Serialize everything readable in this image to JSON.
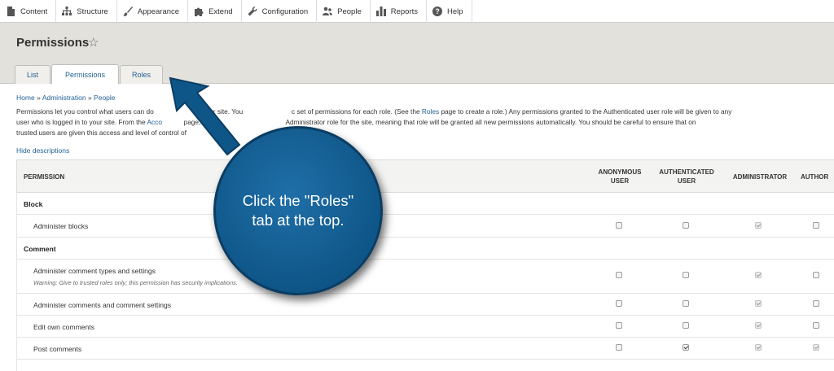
{
  "toolbar": {
    "items": [
      {
        "label": "Content",
        "icon": "document-icon"
      },
      {
        "label": "Structure",
        "icon": "structure-icon"
      },
      {
        "label": "Appearance",
        "icon": "paintbrush-icon"
      },
      {
        "label": "Extend",
        "icon": "puzzle-icon"
      },
      {
        "label": "Configuration",
        "icon": "wrench-icon"
      },
      {
        "label": "People",
        "icon": "people-icon"
      },
      {
        "label": "Reports",
        "icon": "bar-chart-icon"
      },
      {
        "label": "Help",
        "icon": "help-icon"
      }
    ]
  },
  "header": {
    "title": "Permissions",
    "tabs": [
      {
        "label": "List",
        "active": false
      },
      {
        "label": "Permissions",
        "active": true
      },
      {
        "label": "Roles",
        "active": false
      }
    ]
  },
  "breadcrumb": {
    "items": [
      "Home",
      "Administration",
      "People"
    ],
    "separator": "»"
  },
  "description": {
    "line1a": "Permissions let you control what users can do",
    "line1b": "your site. You",
    "line1c": "c set of permissions for each role. (See the",
    "roles_link": "Roles",
    "line1d": "page to create a role.) Any permissions granted to the Authenticated user role will be given to any",
    "line2a": "user who is logged in to your site. From the",
    "account_link": "Acco",
    "line2b": "page,",
    "line2c": "Administrator role for the site, meaning that role will be granted all new permissions automatically. You should be careful to ensure that on",
    "line3": "trusted users are given this access and level of control of",
    "hide_descriptions": "Hide descriptions"
  },
  "table": {
    "headers": {
      "permission": "PERMISSION",
      "anonymous": "ANONYMOUS USER",
      "authenticated": "AUTHENTICATED USER",
      "administrator": "ADMINISTRATOR",
      "author": "AUTHOR"
    },
    "categories": [
      {
        "name": "Block",
        "permissions": [
          {
            "name": "Administer blocks",
            "warning": "",
            "anonymous": false,
            "authenticated": false,
            "administrator": true,
            "author": false
          }
        ]
      },
      {
        "name": "Comment",
        "permissions": [
          {
            "name": "Administer comment types and settings",
            "warning": "Warning: Give to trusted roles only; this permission has security implications.",
            "anonymous": false,
            "authenticated": false,
            "administrator": true,
            "author": false
          },
          {
            "name": "Administer comments and comment settings",
            "warning": "",
            "anonymous": false,
            "authenticated": false,
            "administrator": true,
            "author": false
          },
          {
            "name": "Edit own comments",
            "warning": "",
            "anonymous": false,
            "authenticated": false,
            "administrator": true,
            "author": false
          },
          {
            "name": "Post comments",
            "warning": "",
            "anonymous": false,
            "authenticated": true,
            "administrator": true,
            "author": true
          }
        ]
      }
    ]
  },
  "callout": {
    "text": "Click the \"Roles\" tab at the top.",
    "color": "#0f5688"
  }
}
